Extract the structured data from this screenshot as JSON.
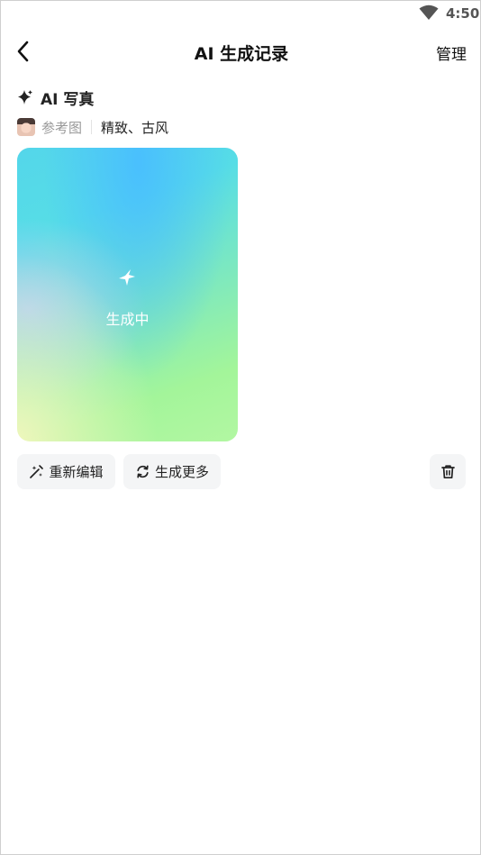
{
  "status_bar": {
    "time": "4:50",
    "wifi_icon": "wifi-icon"
  },
  "header": {
    "title": "AI 生成记录",
    "manage_label": "管理",
    "back_icon": "back-chevron-icon"
  },
  "section": {
    "title": "AI 写真",
    "icon": "sparkle-icon",
    "reference_label": "参考图",
    "style_tags": "精致、古风"
  },
  "card": {
    "status": "生成中",
    "icon": "star-icon",
    "gradient_colors": [
      "#49beff",
      "#54d6ea",
      "#7fe9bd",
      "#a3f59a",
      "#f3f7be",
      "#b2ccfa"
    ]
  },
  "actions": {
    "reedit_label": "重新编辑",
    "more_label": "生成更多",
    "reedit_icon": "edit-wand-icon",
    "more_icon": "refresh-icon",
    "delete_icon": "trash-icon"
  }
}
